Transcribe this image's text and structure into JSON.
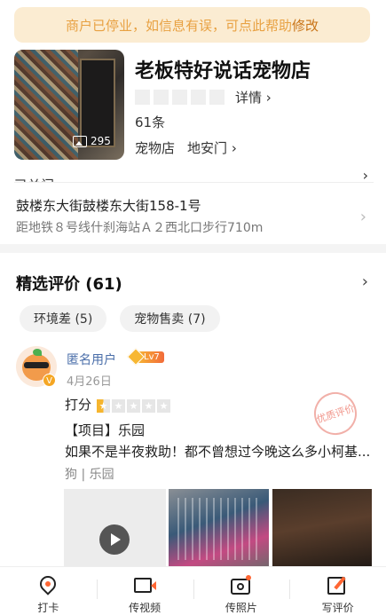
{
  "notice": {
    "text": "商户已停业，如信息有误，可点此帮助",
    "link": "修改"
  },
  "shop": {
    "photo_count": "295",
    "name": "老板特好说话宠物店",
    "detail_link": "详情",
    "review_count": "61条",
    "category": "宠物店",
    "area": "地安门",
    "cut_status_text": "已关门",
    "address": "鼓楼东大街鼓楼东大街158-1号",
    "distance": "距地铁８号线什刹海站Ａ２西北口步行710m"
  },
  "reviews_section": {
    "title": "精选评价 (61)",
    "tags": [
      "环境差 (5)",
      "宠物售卖 (7)"
    ]
  },
  "review": {
    "user": "匿名用户",
    "level": "Lv7",
    "avatar_badge": "V",
    "date": "4月26日",
    "score_label": "打分",
    "stamp_text": "优质评价",
    "project": "【项目】乐园",
    "text": "如果不是半夜救助！都不曾想过今晚这么多小柯基...",
    "pet_tags": "狗 | 乐园",
    "score": 0.5
  },
  "tabbar": {
    "checkin": "打卡",
    "video": "传视频",
    "photo": "传照片",
    "write": "写评价"
  },
  "colors": {
    "accent": "#ff6633",
    "notice_bg": "#fbecd2",
    "notice_text": "#e8a142",
    "link_blue": "#4a6ea9"
  }
}
